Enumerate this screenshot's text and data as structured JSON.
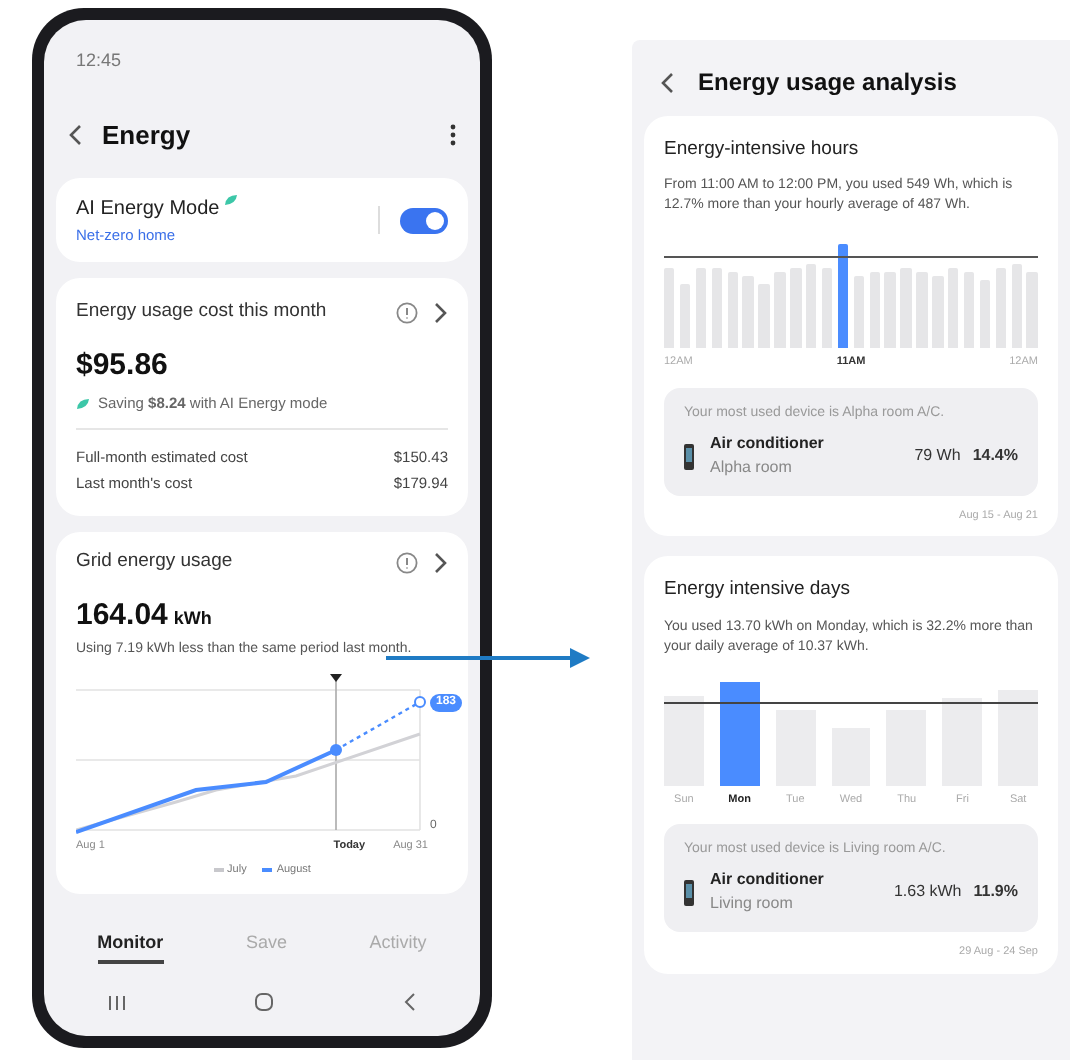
{
  "phone": {
    "status_time": "12:45",
    "title": "Energy",
    "ai_mode": {
      "label": "AI Energy Mode",
      "sublabel": "Net-zero home",
      "on": true
    },
    "cost": {
      "title": "Energy usage cost this month",
      "amount": "$95.86",
      "saving_text": "Saving **$8.24** with AI Energy mode",
      "rows": [
        {
          "label": "Full-month estimated cost",
          "value": "$150.43"
        },
        {
          "label": "Last month's cost",
          "value": "$179.94"
        }
      ]
    },
    "grid": {
      "title": "Grid energy usage",
      "value": "164.04",
      "unit": "kWh",
      "note": "Using 7.19 kWh less than the same period last month.",
      "x_labels": [
        "Aug 1",
        "Today",
        "Aug 31"
      ],
      "axis_zero": "0",
      "badge": "183",
      "legend": [
        {
          "label": "July",
          "color": "#c8c8cc"
        },
        {
          "label": "August",
          "color": "#4a8cff"
        }
      ]
    },
    "tabs": [
      {
        "label": "Monitor",
        "selected": true
      },
      {
        "label": "Save",
        "selected": false
      },
      {
        "label": "Activity",
        "selected": false
      }
    ]
  },
  "analysis": {
    "title": "Energy usage analysis",
    "hours": {
      "title": "Energy-intensive hours",
      "text": "From 11:00 AM to 12:00 PM, you used 549 Wh, which is 12.7% more than your hourly average of 487 Wh.",
      "bars": [
        {
          "selected": false
        },
        {
          "selected": false
        },
        {
          "selected": false
        },
        {
          "selected": false
        },
        {
          "selected": false
        },
        {
          "selected": false
        },
        {
          "selected": false
        },
        {
          "selected": false
        },
        {
          "selected": false
        },
        {
          "selected": false
        },
        {
          "selected": false
        },
        {
          "selected": true
        },
        {
          "selected": false
        },
        {
          "selected": false
        },
        {
          "selected": false
        },
        {
          "selected": false
        },
        {
          "selected": false
        },
        {
          "selected": false
        },
        {
          "selected": false
        },
        {
          "selected": false
        },
        {
          "selected": false
        },
        {
          "selected": false
        },
        {
          "selected": false
        },
        {
          "selected": false
        }
      ],
      "axis_labels": [
        {
          "label": "12AM",
          "selected": false
        },
        {
          "label": "11AM",
          "selected": true
        },
        {
          "label": "12AM",
          "selected": false
        }
      ],
      "device": {
        "intro": "Your most used device is Alpha room A/C.",
        "name": "Air conditioner",
        "room": "Alpha room",
        "usage": "79 Wh",
        "share": "14.4%"
      },
      "period": "Aug 15 - Aug 21"
    },
    "days": {
      "title": "Energy intensive days",
      "text": "You used 13.70 kWh on Monday, which is 32.2% more than your daily average of 10.37 kWh.",
      "days": [
        {
          "label": "Sun",
          "selected": false
        },
        {
          "label": "Mon",
          "selected": true
        },
        {
          "label": "Tue",
          "selected": false
        },
        {
          "label": "Wed",
          "selected": false
        },
        {
          "label": "Thu",
          "selected": false
        },
        {
          "label": "Fri",
          "selected": false
        },
        {
          "label": "Sat",
          "selected": false
        }
      ],
      "device": {
        "intro": "Your most used device is Living room A/C.",
        "name": "Air conditioner",
        "room": "Living room",
        "usage": "1.63 kWh",
        "share": "11.9%"
      },
      "period": "29 Aug - 24 Sep"
    }
  }
}
